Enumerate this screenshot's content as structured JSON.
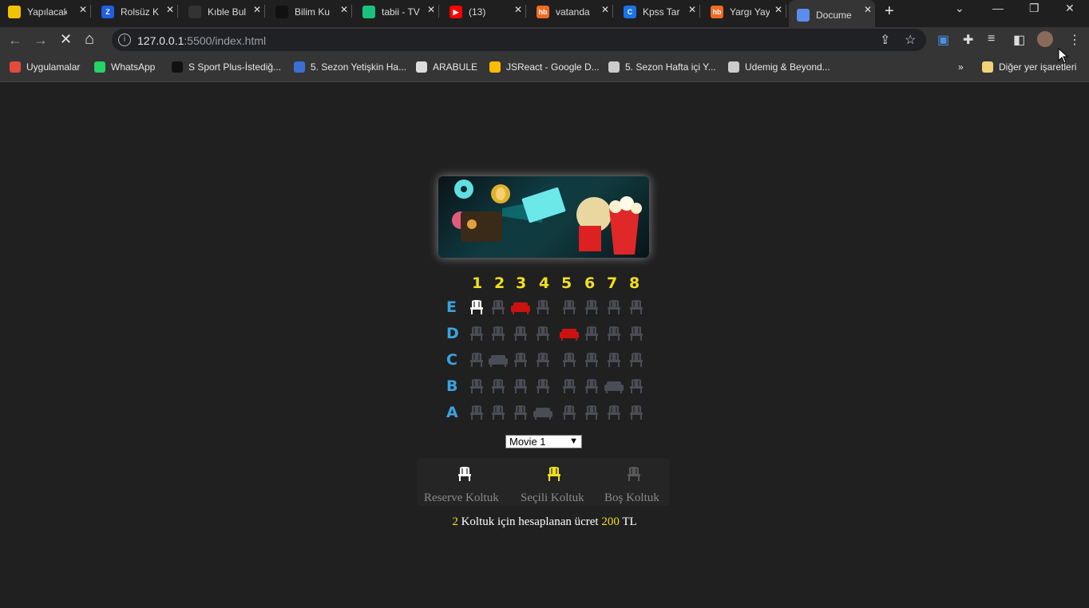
{
  "browser": {
    "tabs": [
      {
        "title": "Yapılacak",
        "fav_color": "#f2c300",
        "fav_text": ""
      },
      {
        "title": "Rolsüz K",
        "fav_color": "#1f5fe0",
        "fav_text": "Z"
      },
      {
        "title": "Kıble Bul",
        "fav_color": "#333333",
        "fav_text": ""
      },
      {
        "title": "Bilim Ku",
        "fav_color": "#111111",
        "fav_text": ""
      },
      {
        "title": "tabii - TV",
        "fav_color": "#19c37d",
        "fav_text": ""
      },
      {
        "title": "(13)",
        "fav_color": "#ff0000",
        "fav_text": "▶"
      },
      {
        "title": "vatanda",
        "fav_color": "#f26a21",
        "fav_text": "hb"
      },
      {
        "title": "Kpss Tar",
        "fav_color": "#1a73e8",
        "fav_text": "C"
      },
      {
        "title": "Yargı Yay",
        "fav_color": "#f26a21",
        "fav_text": "hb"
      },
      {
        "title": "Docume",
        "fav_color": "#5b8def",
        "fav_text": ""
      }
    ],
    "url_host": "127.0.0.1",
    "url_rest": ":5500/index.html",
    "bookmarks": [
      {
        "label": "Uygulamalar",
        "color": "#e34b3c"
      },
      {
        "label": "WhatsApp",
        "color": "#25d366"
      },
      {
        "label": "S Sport Plus-İstediğ...",
        "color": "#111111"
      },
      {
        "label": "5. Sezon Yetişkin Ha...",
        "color": "#3b6fd8"
      },
      {
        "label": "ARABULE",
        "color": "#dddddd"
      },
      {
        "label": "JSReact - Google D...",
        "color": "#fbbc04"
      },
      {
        "label": "5. Sezon Hafta içi Y...",
        "color": "#cccccc"
      },
      {
        "label": "Udemig & Beyond...",
        "color": "#cccccc"
      }
    ],
    "other_bookmarks": "Diğer yer işaretleri",
    "overflow": "»"
  },
  "cinema": {
    "columns": [
      "1",
      "2",
      "3",
      "4",
      "5",
      "6",
      "7",
      "8"
    ],
    "rows": [
      {
        "label": "E",
        "seats": [
          "selected-white",
          "empty",
          "reserved-red",
          "empty",
          "empty",
          "empty",
          "empty",
          "empty"
        ]
      },
      {
        "label": "D",
        "seats": [
          "empty",
          "empty",
          "empty",
          "empty",
          "reserved-red",
          "empty",
          "empty",
          "empty"
        ]
      },
      {
        "label": "C",
        "seats": [
          "empty",
          "sofa",
          "empty",
          "empty",
          "empty",
          "empty",
          "empty",
          "empty"
        ]
      },
      {
        "label": "B",
        "seats": [
          "empty",
          "empty",
          "empty",
          "empty",
          "empty",
          "empty",
          "sofa",
          "empty"
        ]
      },
      {
        "label": "A",
        "seats": [
          "empty",
          "empty",
          "empty",
          "sofa",
          "empty",
          "empty",
          "empty",
          "empty"
        ]
      }
    ],
    "movie_select": {
      "selected": "Movie 1"
    },
    "legend": [
      {
        "label": "Reserve Koltuk",
        "color": "#ffffff"
      },
      {
        "label": "Seçili Koltuk",
        "color": "#f0e020"
      },
      {
        "label": "Boş Koltuk",
        "color": "#5a5a5a"
      }
    ],
    "summary": {
      "count": "2",
      "text_mid": " Koltuk için hesaplanan ücret ",
      "price": "200",
      "currency": " TL"
    }
  },
  "colors": {
    "seat_empty": "#4a4d55",
    "seat_reserved": "#cc1111",
    "seat_white": "#ffffff",
    "accent_yellow": "#f0e020",
    "row_label_blue": "#3aa3e0"
  }
}
